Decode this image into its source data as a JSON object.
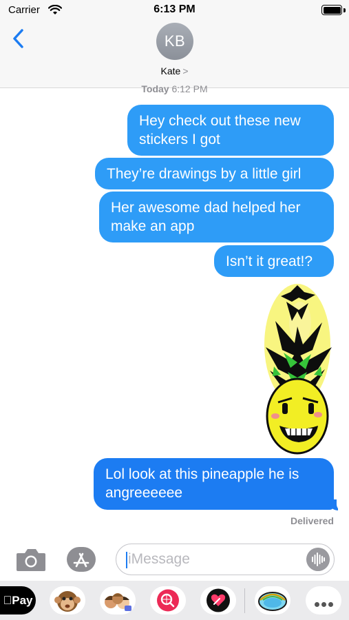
{
  "status_bar": {
    "carrier": "Carrier",
    "time": "6:13 PM"
  },
  "conversation": {
    "avatar_initials": "KB",
    "contact_name": "Kate",
    "contact_chevron": ">",
    "timestamp_day": "Today",
    "timestamp_time": "6:12 PM"
  },
  "messages": [
    "Hey check out these new stickers I got",
    "They’re drawings by a little girl",
    "Her awesome dad helped her make an app",
    "Isn’t it great!?",
    "Lol look at this pineapple he is angreeeeee"
  ],
  "delivery_status": "Delivered",
  "composer": {
    "placeholder": "iMessage"
  },
  "app_drawer": {
    "apple_pay_label": "Pay",
    "apps": [
      "apple-pay",
      "animoji",
      "memoji",
      "web-images",
      "digital-touch",
      "sticker-pack",
      "more"
    ]
  },
  "colors": {
    "outgoing_bubble": "#2e9cf7",
    "last_bubble": "#1c7cf2",
    "accent": "#1c7cf2"
  }
}
